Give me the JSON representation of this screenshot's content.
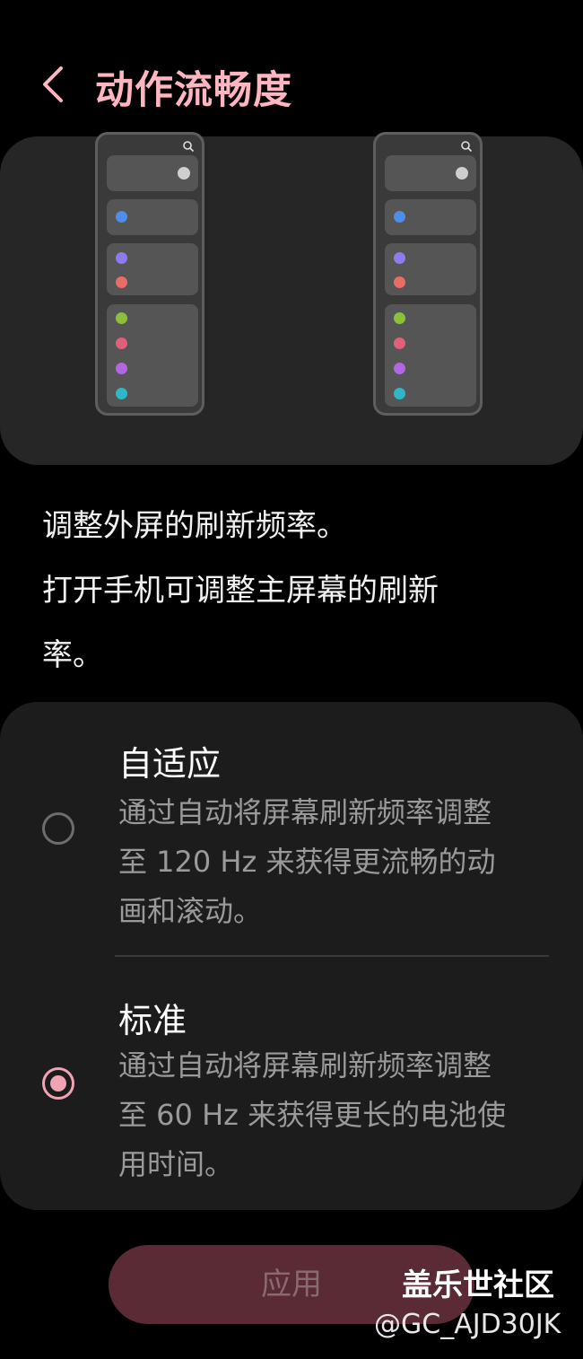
{
  "header": {
    "title": "动作流畅度",
    "back_icon": "chevron-left-icon"
  },
  "preview": {
    "dot_colors": [
      "#4e8de8",
      "#8d7cf0",
      "#e96d63",
      "#8bc13a",
      "#e0607a",
      "#b266e0",
      "#2fb7c9"
    ],
    "toggle_color": "#cfcfcf",
    "search_icon": "search-icon"
  },
  "description": {
    "line1": "调整外屏的刷新频率。",
    "line2": "打开手机可调整主屏幕的刷新",
    "line3": "率。"
  },
  "options": [
    {
      "title": "自适应",
      "sub1": "通过自动将屏幕刷新频率调整",
      "sub2": "至 120 Hz 来获得更流畅的动",
      "sub3": "画和滚动。",
      "selected": false
    },
    {
      "title": "标准",
      "sub1": "通过自动将屏幕刷新频率调整",
      "sub2": "至 60 Hz 来获得更长的电池使",
      "sub3": "用时间。",
      "selected": true
    }
  ],
  "apply_label": "应用",
  "accent_color": "#f0a3b2",
  "watermark": {
    "line1": "盖乐世社区",
    "line2": "@GC_AJD30JK"
  }
}
